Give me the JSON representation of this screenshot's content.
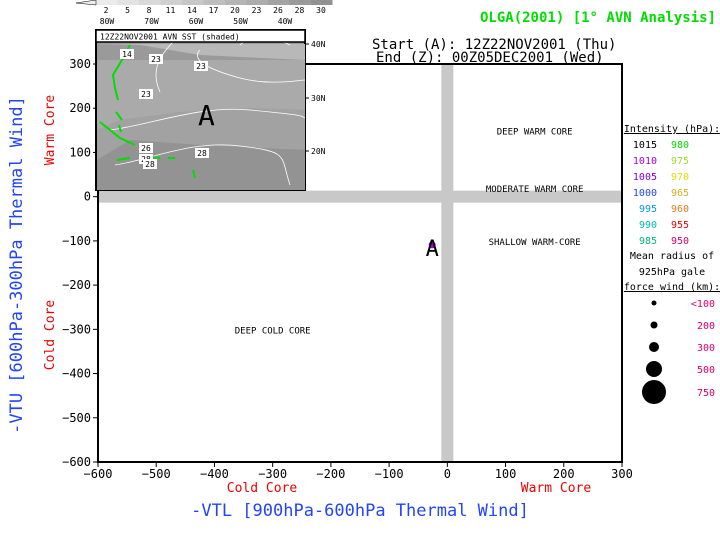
{
  "header": {
    "title": "OLGA(2001) [1° AVN Analysis]",
    "start": "Start (A): 12Z22NOV2001 (Thu)",
    "end": "End (Z): 00Z05DEC2001 (Wed)",
    "title_color": "#00dd00"
  },
  "inset": {
    "title": "12Z22NOV2001 AVN SST (shaded)",
    "colorbar_ticks": [
      "2",
      "5",
      "8",
      "11",
      "14",
      "17",
      "20",
      "23",
      "26",
      "28",
      "30"
    ],
    "lon_labels": [
      "80W",
      "70W",
      "60W",
      "50W",
      "40W"
    ],
    "lat_labels": [
      "40N",
      "30N",
      "20N"
    ],
    "contour_labels": [
      "14",
      "23",
      "23",
      "23",
      "26",
      "28",
      "28",
      "28"
    ],
    "marker": "A"
  },
  "chart_data": {
    "type": "scatter",
    "title": "OLGA(2001) [1° AVN Analysis]",
    "xlabel": "-VTL [900hPa-600hPa Thermal Wind]",
    "ylabel": "-VTU [600hPa-300hPa Thermal Wind]",
    "xlim": [
      -600,
      300
    ],
    "ylim": [
      -600,
      300
    ],
    "xticks": [
      -600,
      -500,
      -400,
      -300,
      -200,
      -100,
      0,
      100,
      200,
      300
    ],
    "yticks": [
      -600,
      -500,
      -400,
      -300,
      -200,
      -100,
      0,
      100,
      200,
      300
    ],
    "x_side_labels": {
      "left": "Cold Core",
      "right": "Warm Core"
    },
    "y_side_labels": {
      "bottom": "Cold Core",
      "top": "Warm Core"
    },
    "regions": [
      {
        "label": "DEEP WARM CORE",
        "x": 150,
        "y": 150
      },
      {
        "label": "MODERATE WARM CORE",
        "x": 150,
        "y": 20
      },
      {
        "label": "SHALLOW WARM-CORE",
        "x": 150,
        "y": -100
      },
      {
        "label": "DEEP COLD CORE",
        "x": -300,
        "y": -300
      }
    ],
    "points": [
      {
        "label": "A",
        "x": -26,
        "y": -109,
        "color": "#aa00dd"
      }
    ],
    "legend": {
      "intensity_title": "Intensity (hPa):",
      "intensity": [
        {
          "v": "1015",
          "c": "#000000"
        },
        {
          "v": "980",
          "c": "#00dd00"
        },
        {
          "v": "1010",
          "c": "#aa00dd"
        },
        {
          "v": "975",
          "c": "#99dd33"
        },
        {
          "v": "1005",
          "c": "#7700ee"
        },
        {
          "v": "970",
          "c": "#dddd00"
        },
        {
          "v": "1000",
          "c": "#2244ff"
        },
        {
          "v": "965",
          "c": "#ddaa22"
        },
        {
          "v": "995",
          "c": "#0099ee"
        },
        {
          "v": "960",
          "c": "#ee7722"
        },
        {
          "v": "990",
          "c": "#00bbbb"
        },
        {
          "v": "955",
          "c": "#ee0000"
        },
        {
          "v": "985",
          "c": "#00bb77"
        },
        {
          "v": "950",
          "c": "#dd0066"
        }
      ],
      "radius_title": [
        "Mean radius of",
        "925hPa gale",
        "force wind (km):"
      ],
      "radii": [
        "<100",
        "200",
        "300",
        "500",
        "750"
      ],
      "placement": "right"
    }
  }
}
